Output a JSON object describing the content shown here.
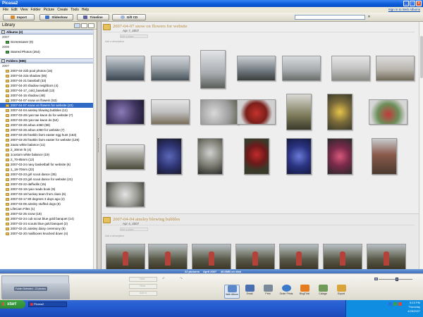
{
  "window": {
    "title": "Picasa2"
  },
  "menu": [
    "File",
    "Edit",
    "View",
    "Folder",
    "Picture",
    "Create",
    "Tools",
    "Help"
  ],
  "signin_link": "Sign in to Web Albums",
  "toolbar": {
    "import": "Import",
    "slideshow": "Slideshow",
    "timeline": "Timeline",
    "giftcd": "Gift CD",
    "search_value": ""
  },
  "library": {
    "title": "Library",
    "albums_header": "Albums (2)",
    "year_2007": "2007",
    "year_2006": "2006",
    "album_screensaver": "Screensaver (0)",
    "album_starred": "Starred Photos (254)",
    "folders_header": "Folders (686)",
    "folders_year": "2007",
    "folders": [
      "2007-04-22b pool photos (15)",
      "2007-04-22a shadow (55)",
      "2007-04-21 baseball (33)",
      "2007-04-20 shadow neighbors (4)",
      "2007-04-17_cold_baseball (13)",
      "2007-04-15 shadow (48)",
      "2007-04-07 snow on flowers (53)",
      "2007-04-07 snow on flowers for website (22)",
      "2007-04-04 ainsley blowing bubbles (11)",
      "2007-03-28 ryan tae kwon do for website (7)",
      "2007-03-28 ryan tae kwon do (52)",
      "2007-03-28 arbus e360 (98)",
      "2007-03-26 arbus e360 for website (7)",
      "2007-03-25 franklin farm easter egg hunt (153)",
      "2007-03-25 franklin farm easter for website (129)",
      "2auto white balance (11)",
      "2_30mm f4 (4)",
      "1custom white balance (19)",
      "2_70-85mm (12)",
      "2007-03-24 navy basketball for website (6)",
      "1_18-70mm (22)",
      "2007-03-23 girl scout dance (35)",
      "2007-03-23 girl scout dance for website (21)",
      "2007-03-22 daffodils (15)",
      "2007-03-19 ryan reads book (9)",
      "2007-03-18 hockey team from class (6)",
      "2007-03-17 80 degrees 3 days ago (2)",
      "2007-03-06 ainsley stuffed dogs (6)",
      "LifeCam Files (1)",
      "2007-02-25 snow (18)",
      "2007-02-24 cub scout blue gold banquet (14)",
      "2007-02-24 scouts blue gold banquet (2)",
      "2007-02-21 ainsley daisy ceremony (5)",
      "2007-02-20 mailboxes knocked down (4)"
    ],
    "selected_index": 7
  },
  "main": {
    "folder1": {
      "title": "2007-04-07 snow on flowers for website",
      "date": "Apr 7, 2007",
      "place": "Add a place",
      "description": "Add a description"
    },
    "folder2": {
      "title": "2007-04-04 ainsley blowing bubbles",
      "date": "Apr 4, 2007",
      "place": "Add a place",
      "description": "Add a description"
    }
  },
  "statusbar": {
    "count": "22 pictures",
    "date": "April 2007",
    "size": "46.6MB on disk"
  },
  "tray": {
    "label": "Folder Selected - 22 photos",
    "side_buttons": [
      "Hold",
      "Clear",
      "Add to"
    ],
    "actions": [
      "Web Album",
      "Email",
      "Print",
      "Order Prints",
      "BlogThis!",
      "Collage",
      "Export"
    ],
    "zoom_level": 0.55
  },
  "taskbar": {
    "start": "start",
    "task": "Picasa2",
    "time": "8:13 PM",
    "day": "Thursday",
    "date": "4/26/2007"
  }
}
